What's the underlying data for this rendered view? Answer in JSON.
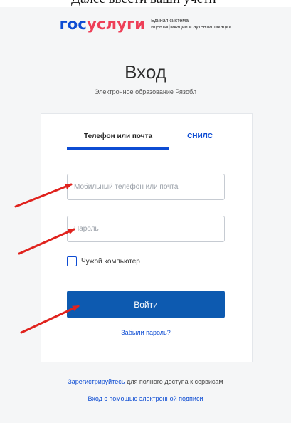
{
  "top_banner": {
    "text": "Далее ввести ваши учетн"
  },
  "logo": {
    "part1": "гос",
    "part2": "услуги",
    "subtitle_line1": "Единая система",
    "subtitle_line2": "идентификации и аутентификации"
  },
  "page": {
    "title": "Вход",
    "subtitle": "Электронное образование Рязобл"
  },
  "tabs": [
    {
      "label": "Телефон или почта",
      "active": true
    },
    {
      "label": "СНИЛС",
      "active": false
    }
  ],
  "form": {
    "login_placeholder": "Мобильный телефон или почта",
    "login_value": "",
    "password_placeholder": "Пароль",
    "password_value": "",
    "checkbox_label": "Чужой компьютер",
    "checkbox_checked": false,
    "submit_label": "Войти",
    "forgot_label": "Забыли пароль?"
  },
  "footer": {
    "register_link": "Зарегистрируйтесь",
    "register_rest": " для полного доступа к сервисам",
    "esign_link": "Вход с помощью электронной подписи"
  },
  "colors": {
    "brand_blue": "#0d4cd3",
    "brand_red": "#ee3f58",
    "button": "#0d5ab0",
    "annotation_arrow": "#e0231e"
  }
}
